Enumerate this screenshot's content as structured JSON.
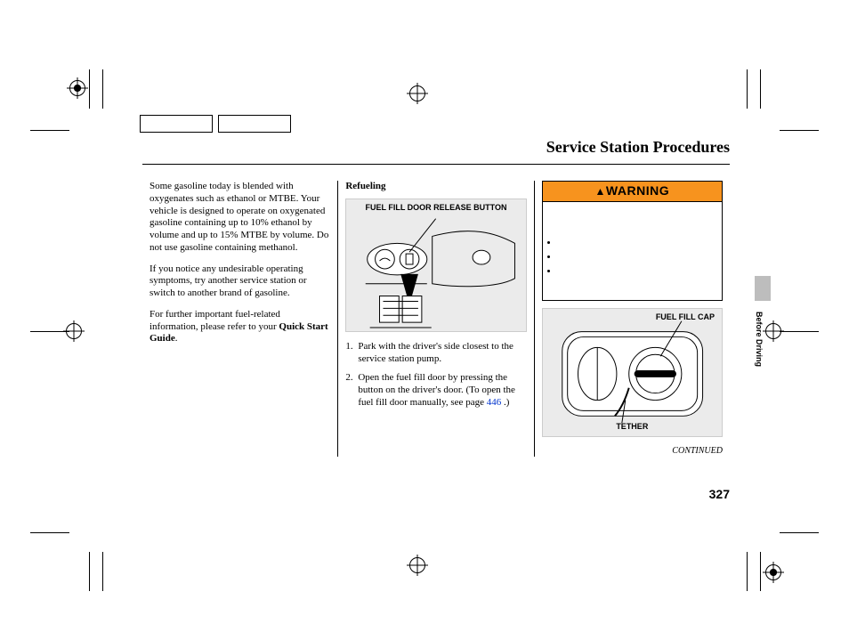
{
  "page_title": "Service Station Procedures",
  "side_tab": "Before Driving",
  "page_number": "327",
  "continued": "CONTINUED",
  "col1": {
    "p1": "Some gasoline today is blended with oxygenates such as ethanol or MTBE. Your vehicle is designed to operate on oxygenated gasoline containing up to 10% ethanol by volume and up to 15% MTBE by volume. Do not use gasoline containing methanol.",
    "p2": "If you notice any undesirable operating symptoms, try another service station or switch to another brand of gasoline.",
    "p3a": "For further important fuel-related information, please refer to your ",
    "p3b": "Quick Start Guide",
    "p3c": "."
  },
  "col2": {
    "heading": "Refueling",
    "fig1_label": "FUEL FILL DOOR RELEASE BUTTON",
    "step1": "Park with the driver's side closest to the service station pump.",
    "step2a": "Open the fuel fill door by pressing the button on the driver's door. (To open the fuel fill door manually, see page ",
    "step2_link": "446",
    "step2b": " .)"
  },
  "col3": {
    "warning_header": "WARNING",
    "fig2_label_top": "FUEL FILL CAP",
    "fig2_label_bottom": "TETHER"
  }
}
